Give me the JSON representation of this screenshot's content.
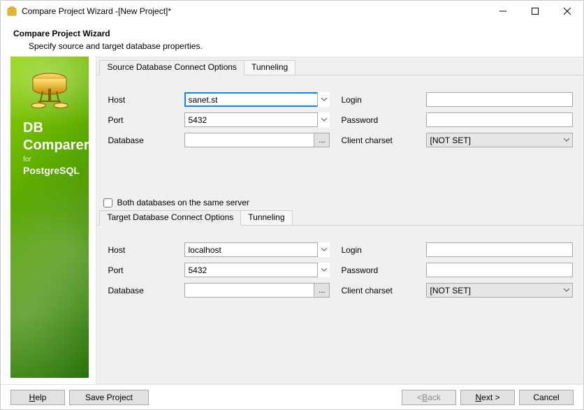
{
  "window": {
    "title": "Compare Project Wizard -[New Project]*"
  },
  "header": {
    "title": "Compare Project Wizard",
    "subtitle": "Specify source and target database properties."
  },
  "sidebar": {
    "line1": "DB",
    "line2": "Comparer",
    "line3": "for",
    "line4": "PostgreSQL"
  },
  "source": {
    "tabs": {
      "connect": "Source Database Connect Options",
      "tunneling": "Tunneling"
    },
    "labels": {
      "host": "Host",
      "port": "Port",
      "database": "Database",
      "login": "Login",
      "password": "Password",
      "charset": "Client charset"
    },
    "values": {
      "host": "sanet.st",
      "port": "5432",
      "database": "",
      "login": "",
      "password": "",
      "charset": "[NOT SET]"
    }
  },
  "same_server": {
    "label": "Both databases on the same server",
    "checked": false
  },
  "target": {
    "tabs": {
      "connect": "Target Database Connect Options",
      "tunneling": "Tunneling"
    },
    "labels": {
      "host": "Host",
      "port": "Port",
      "database": "Database",
      "login": "Login",
      "password": "Password",
      "charset": "Client charset"
    },
    "values": {
      "host": "localhost",
      "port": "5432",
      "database": "",
      "login": "",
      "password": "",
      "charset": "[NOT SET]"
    }
  },
  "footer": {
    "help": "Help",
    "save": "Save Project",
    "back": "Back",
    "next": "Next >",
    "cancel": "Cancel",
    "back_prefix": "< ",
    "help_key": "H",
    "back_key": "B",
    "next_key": "N"
  },
  "browse_dots": "..."
}
